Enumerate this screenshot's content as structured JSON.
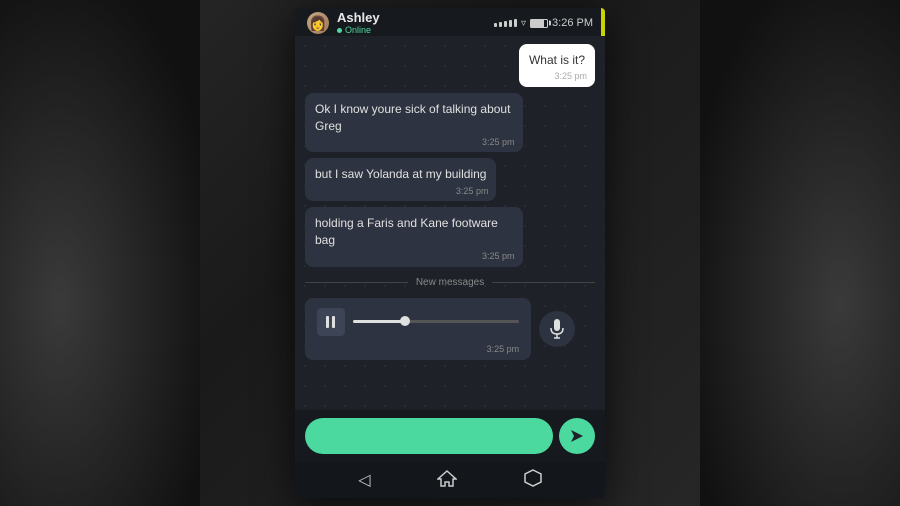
{
  "statusBar": {
    "contactName": "Ashley",
    "statusText": "Online",
    "time": "3:26 PM"
  },
  "messages": [
    {
      "id": "msg-sent-1",
      "type": "sent",
      "text": "What is it?",
      "time": "3:25 pm"
    },
    {
      "id": "msg-recv-1",
      "type": "received",
      "text": "Ok I know youre sick of talking about Greg",
      "time": "3:25 pm"
    },
    {
      "id": "msg-recv-2",
      "type": "received",
      "text": "but I saw Yolanda at my building",
      "time": "3:25 pm"
    },
    {
      "id": "msg-recv-3",
      "type": "received",
      "text": "holding a Faris and Kane footware bag",
      "time": "3:25 pm"
    }
  ],
  "divider": {
    "text": "New messages"
  },
  "audioMessage": {
    "time": "3:25 pm"
  },
  "input": {
    "placeholder": ""
  },
  "nav": {
    "back": "◁",
    "home": "⌂",
    "recent": "⬡"
  },
  "colors": {
    "accent": "#4cd9a0",
    "yellow": "#c8d400",
    "bubbleReceived": "#2d3340",
    "bubbleSent": "#ffffff"
  }
}
